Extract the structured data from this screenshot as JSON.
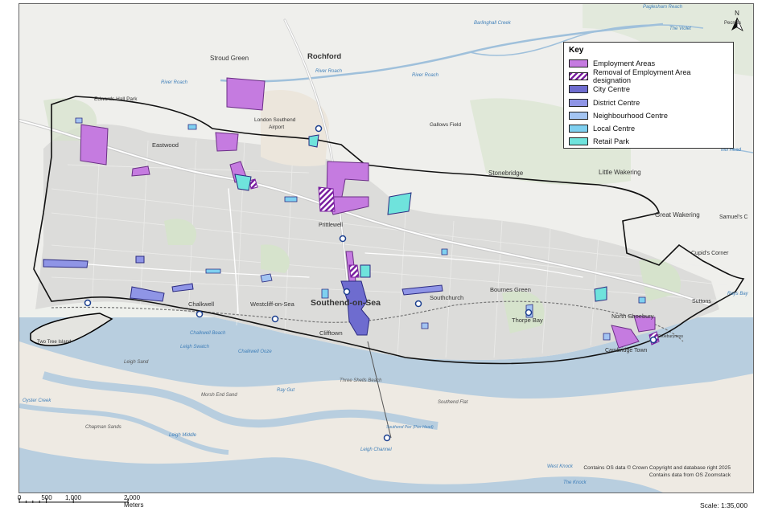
{
  "legend": {
    "title": "Key",
    "items": [
      {
        "label": "Employment Areas",
        "color": "#c57be0",
        "pattern": "solid"
      },
      {
        "label": "Removal of Employment Area designation",
        "color": "#7a1fa0",
        "pattern": "hatch"
      },
      {
        "label": "City Centre",
        "color": "#6e6ccf",
        "pattern": "solid"
      },
      {
        "label": "District Centre",
        "color": "#8f95e6",
        "pattern": "solid"
      },
      {
        "label": "Neighbourhood Centre",
        "color": "#a3c4f2",
        "pattern": "solid"
      },
      {
        "label": "Local Centre",
        "color": "#7fd0f0",
        "pattern": "solid"
      },
      {
        "label": "Retail Park",
        "color": "#6fe3dc",
        "pattern": "solid"
      }
    ]
  },
  "places": {
    "rochford": "Rochford",
    "stroud_green": "Stroud Green",
    "eastwood": "Eastwood",
    "airport": "London Southend",
    "airport2": "Airport",
    "southend": "Southend-on-Sea",
    "prittlewell": "Prittlewell",
    "stonebridge": "Stonebridge",
    "little_wakering": "Little Wakering",
    "great_wakering": "Great Wakering",
    "samuels": "Samuel's C",
    "cupids": "Cupid's Corner",
    "bournes_green": "Bournes Green",
    "southchurch": "Southchurch",
    "thorpe_bay": "Thorpe Bay",
    "north_shoebury": "North Shoebury",
    "suttons": "Suttons",
    "shoeburyness": "Shoeburyness",
    "cambridge_town": "Cambridge Town",
    "chalkwell": "Chalkwell",
    "westcliff": "Westcliff-on-Sea",
    "clifftown": "Clifftown",
    "two_tree": "Two Tree Island",
    "gallows_field": "Gallows Field",
    "edwards_hall_park": "Edwards Hall Park"
  },
  "water": {
    "roach1": "River Roach",
    "roach2": "River Roach",
    "roach3": "River Roach",
    "barling": "Barlinghall Creek",
    "paglesham": "Paglesham Reach",
    "violet": "The Violet",
    "chalkwell_beach": "Chalkwell Beach",
    "leigh_swatch": "Leigh Swatch",
    "chalkwell_ooze": "Chalkwell Ooze",
    "leigh_sand": "Leigh Sand",
    "three_shells": "Three Shells Beach",
    "ray_gut": "Ray Gut",
    "morsh_end_sand": "Morsh End Sand",
    "southend_flat": "Southend Flat",
    "oyster_creek": "Oyster Creek",
    "chapman_sands": "Chapman Sands",
    "leigh_middle": "Leigh Middle",
    "leigh_channel": "Leigh Channel",
    "west_knock": "West Knock",
    "knock": "The Knock",
    "pier": "Southend Pier (Pier Head)",
    "mill_head": "Mill Head",
    "hays_bay": "Rays Bay"
  },
  "north_arrow": "N",
  "north_text": "Pecniss",
  "scalebar": {
    "ticks": [
      "0",
      "500",
      "1,000",
      "2,000 Meters"
    ]
  },
  "scale_text": "Scale: 1:35,000",
  "copyright": {
    "line1": "Contains OS data © Crown Copyright and database right 2025",
    "line2": "Contains data from OS Zoomstack"
  }
}
